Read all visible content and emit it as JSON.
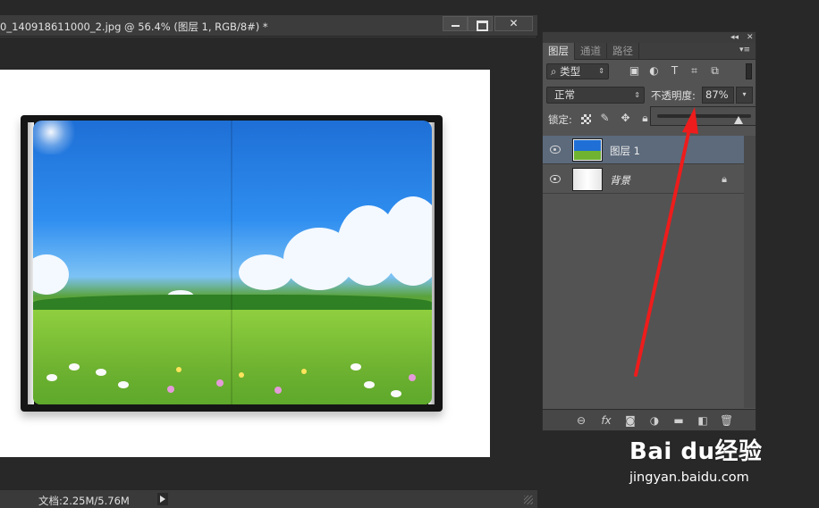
{
  "document": {
    "title": "0_140918611000_2.jpg @ 56.4% (图层 1, RGB/8#) *",
    "status_text": "文档:2.25M/5.76M"
  },
  "window_controls": {
    "close_label": "✕"
  },
  "panel": {
    "collapse": "◂◂",
    "close": "✕",
    "tabs": [
      {
        "label": "图层",
        "active": true
      },
      {
        "label": "通道",
        "active": false
      },
      {
        "label": "路径",
        "active": false
      }
    ],
    "menu_icon": "▾≡",
    "filter": {
      "label": "类型",
      "prefix": "⌕",
      "arrow": "⇕",
      "icons": [
        "image-filter-icon",
        "adjustment-filter-icon",
        "type-filter-icon",
        "shape-filter-icon",
        "smart-object-filter-icon"
      ]
    },
    "blend_mode": {
      "value": "正常",
      "arrow": "⇕"
    },
    "opacity": {
      "label": "不透明度:",
      "value": "87%",
      "percent": 87,
      "drop": "▾"
    },
    "lock": {
      "label": "锁定:",
      "icons": [
        "lock-transparent-icon",
        "lock-paint-icon",
        "lock-move-icon",
        "lock-all-icon"
      ]
    },
    "layers": [
      {
        "name": "图层 1",
        "selected": true,
        "visible": true,
        "locked": false
      },
      {
        "name": "背景",
        "selected": false,
        "visible": true,
        "locked": true
      }
    ],
    "footer_icons": [
      "link-icon",
      "fx-icon",
      "mask-icon",
      "adjustment-icon",
      "group-folder-icon",
      "new-layer-icon",
      "trash-icon"
    ],
    "fx_label": "fx"
  },
  "annotation": {
    "color": "#ee1c1c"
  },
  "watermark": {
    "logo": "Bai du经验",
    "url": "jingyan.baidu.com"
  }
}
